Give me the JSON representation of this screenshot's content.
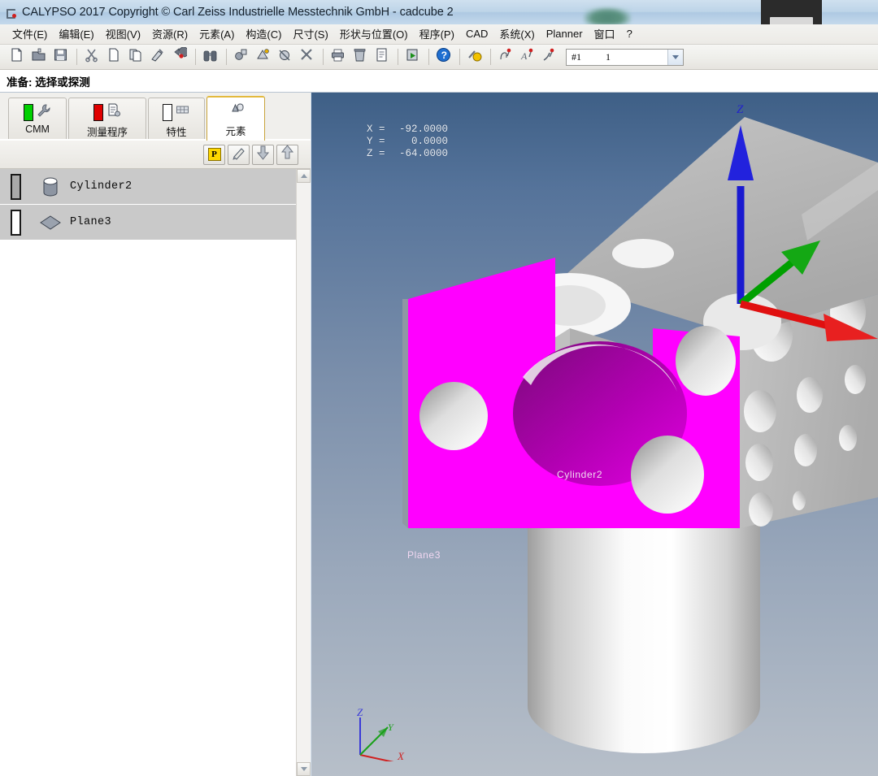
{
  "window": {
    "title": "CALYPSO 2017 Copyright © Carl Zeiss Industrielle Messtechnik GmbH - cadcube 2",
    "app_icon": "calypso-icon"
  },
  "menubar": {
    "items": [
      {
        "label": "文件(E)",
        "name": "menu-file"
      },
      {
        "label": "编辑(E)",
        "name": "menu-edit"
      },
      {
        "label": "视图(V)",
        "name": "menu-view"
      },
      {
        "label": "资源(R)",
        "name": "menu-resources"
      },
      {
        "label": "元素(A)",
        "name": "menu-features"
      },
      {
        "label": "构造(C)",
        "name": "menu-construction"
      },
      {
        "label": "尺寸(S)",
        "name": "menu-dimension"
      },
      {
        "label": "形状与位置(O)",
        "name": "menu-form-location"
      },
      {
        "label": "程序(P)",
        "name": "menu-program"
      },
      {
        "label": "CAD",
        "name": "menu-cad"
      },
      {
        "label": "系统(X)",
        "name": "menu-system"
      },
      {
        "label": "Planner",
        "name": "menu-planner"
      },
      {
        "label": "窗口",
        "name": "menu-window"
      },
      {
        "label": "?",
        "name": "menu-help"
      }
    ]
  },
  "toolbar": {
    "buttons": [
      {
        "icon": "new-document-icon",
        "name": "new-button"
      },
      {
        "icon": "open-folder-icon",
        "name": "open-button"
      },
      {
        "icon": "save-disk-icon",
        "name": "save-button"
      },
      {
        "sep": true
      },
      {
        "icon": "scissors-cut-icon",
        "name": "cut-button"
      },
      {
        "icon": "copy-page-icon",
        "name": "copy-button"
      },
      {
        "icon": "paste-pages-icon",
        "name": "paste-button"
      },
      {
        "icon": "format-brush-icon",
        "name": "format-painter-button"
      },
      {
        "icon": "undo-arrow-icon",
        "name": "undo-button"
      },
      {
        "sep": true
      },
      {
        "icon": "binoculars-icon",
        "name": "find-button"
      },
      {
        "sep": true
      },
      {
        "icon": "feature-gear-icon",
        "name": "feature-button"
      },
      {
        "icon": "measure-plan-icon",
        "name": "measurement-plan-button"
      },
      {
        "icon": "nominal-geometry-icon",
        "name": "nominal-button"
      },
      {
        "icon": "tools-cross-icon",
        "name": "tools-button"
      },
      {
        "sep": true
      },
      {
        "icon": "printer-icon",
        "name": "print-button"
      },
      {
        "icon": "trash-bin-icon",
        "name": "delete-button"
      },
      {
        "icon": "report-list-icon",
        "name": "report-button"
      },
      {
        "sep": true
      },
      {
        "icon": "run-export-icon",
        "name": "run-button"
      },
      {
        "sep": true
      },
      {
        "icon": "help-question-icon",
        "name": "help-button"
      },
      {
        "sep": true
      },
      {
        "icon": "settings-gear-icon",
        "name": "settings-button"
      },
      {
        "sep": true
      },
      {
        "icon": "hand-probe-icon",
        "name": "probe-hand-button"
      },
      {
        "icon": "autotext-probe-icon",
        "name": "auto-probe-button"
      },
      {
        "icon": "curve-probe-icon",
        "name": "curve-probe-button"
      }
    ],
    "combo": {
      "value_left": "#1",
      "value_right": "1",
      "name": "probe-selector"
    }
  },
  "status": {
    "text": "准备: 选择或探测"
  },
  "tabs": [
    {
      "label": "CMM",
      "name": "tab-cmm",
      "icons": [
        "green-status-bar-icon",
        "wrench-icon"
      ],
      "active": false
    },
    {
      "label": "测量程序",
      "name": "tab-measurement-plan",
      "icons": [
        "red-status-bar-icon",
        "document-gear-icon"
      ],
      "active": false
    },
    {
      "label": "特性",
      "name": "tab-characteristics",
      "icons": [
        "white-status-bar-icon",
        "table-icon"
      ],
      "active": false
    },
    {
      "label": "元素",
      "name": "tab-features",
      "icons": [
        "shapes-icon"
      ],
      "active": true
    }
  ],
  "mini_toolbar": {
    "buttons": [
      {
        "icon": "p-badge-icon",
        "label": "P",
        "name": "nominal-p-button"
      },
      {
        "icon": "pencil-icon",
        "name": "edit-pencil-button"
      },
      {
        "icon": "arrow-down-icon",
        "name": "move-down-button"
      },
      {
        "icon": "arrow-up-icon",
        "name": "move-up-button"
      }
    ]
  },
  "feature_list": {
    "rows": [
      {
        "label": "Cylinder2",
        "icon": "cylinder-icon",
        "marker": "filled",
        "name": "feature-row-cylinder2"
      },
      {
        "label": "Plane3",
        "icon": "plane-icon",
        "marker": "empty",
        "name": "feature-row-plane3"
      }
    ]
  },
  "viewport": {
    "coordinates": [
      {
        "axis": "X =",
        "value": "-92.0000"
      },
      {
        "axis": "Y =",
        "value": "0.0000"
      },
      {
        "axis": "Z =",
        "value": "-64.0000"
      }
    ],
    "model_labels": [
      {
        "text": "Cylinder2",
        "name": "model-label-cylinder2"
      },
      {
        "text": "Plane3",
        "name": "model-label-plane3"
      }
    ],
    "big_axes": [
      {
        "letter": "Z",
        "color": "#1a1ad0",
        "name": "axis-z-arrow"
      },
      {
        "letter": "",
        "color": "#00a000",
        "name": "axis-y-arrow"
      },
      {
        "letter": "",
        "color": "#e01010",
        "name": "axis-x-arrow"
      }
    ],
    "triad": [
      {
        "letter": "Z",
        "color": "#3a3ad8",
        "name": "triad-z"
      },
      {
        "letter": "Y",
        "color": "#1aa01a",
        "name": "triad-y"
      },
      {
        "letter": "X",
        "color": "#d02020",
        "name": "triad-x"
      }
    ],
    "colors": {
      "selected_face": "#ff00ff",
      "body": "#b8b8b8",
      "background_top": "#3e5f86",
      "background_bottom": "#b7bfc9"
    }
  }
}
